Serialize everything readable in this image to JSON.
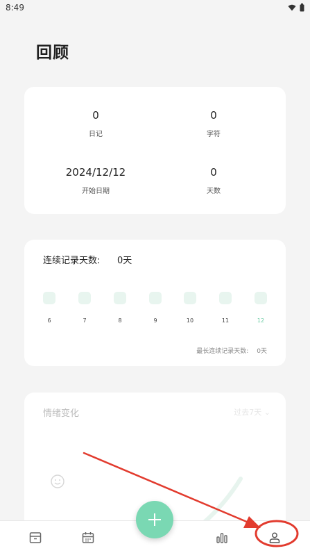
{
  "status_bar": {
    "time": "8:49",
    "icons": [
      "wifi-icon",
      "battery-icon"
    ]
  },
  "page": {
    "title": "回顾"
  },
  "stats": {
    "diary": {
      "value": "0",
      "label": "日记"
    },
    "chars": {
      "value": "0",
      "label": "字符"
    },
    "start_date": {
      "value": "2024/12/12",
      "label": "开始日期"
    },
    "days": {
      "value": "0",
      "label": "天数"
    }
  },
  "streak": {
    "title": "连续记录天数:",
    "value": "0天",
    "days": [
      "6",
      "7",
      "8",
      "9",
      "10",
      "11",
      "12"
    ],
    "today": "12",
    "longest_label": "最长连续记录天数:",
    "longest_value": "0天"
  },
  "mood": {
    "title": "情绪变化",
    "range": "过去7天"
  },
  "tabbar": {
    "items": [
      "archive-icon",
      "calendar-icon",
      "add-icon",
      "stats-icon",
      "profile-icon"
    ]
  },
  "colors": {
    "accent": "#7ad8b3",
    "annotation": "#e23b2e",
    "background": "#f4f4f4",
    "card": "#ffffff"
  }
}
